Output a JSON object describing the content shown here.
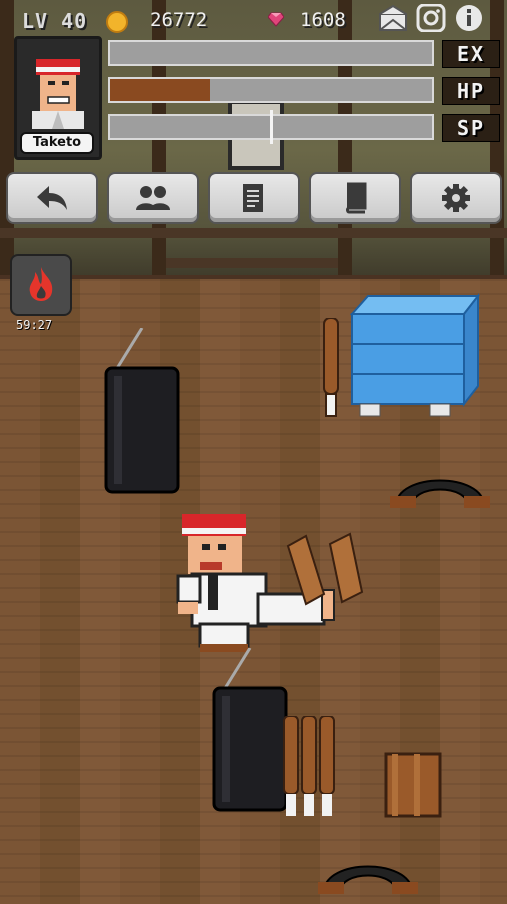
{
  "status": {
    "level_label": "LV 40",
    "coins": "26772",
    "gems": "1608"
  },
  "player": {
    "name": "Taketo"
  },
  "bars": [
    {
      "label": "EX",
      "fill": 0.0,
      "color": "#9e9e9e"
    },
    {
      "label": "HP",
      "fill": 0.31,
      "color": "#8a4a20"
    },
    {
      "label": "SP",
      "fill": 0.5,
      "color": "#9e9e9e"
    }
  ],
  "menu": [
    {
      "icon": "back-arrow-icon"
    },
    {
      "icon": "friends-icon"
    },
    {
      "icon": "quest-scroll-icon"
    },
    {
      "icon": "book-icon"
    },
    {
      "icon": "gear-icon"
    }
  ],
  "skill": {
    "icon": "fire-icon",
    "timer": "59:27"
  },
  "colors": {
    "floor": "#7b5535",
    "wall": "#6b6848",
    "hp_fill": "#8a4a20",
    "coin": "#f2b42b",
    "gem": "#e0457b"
  }
}
